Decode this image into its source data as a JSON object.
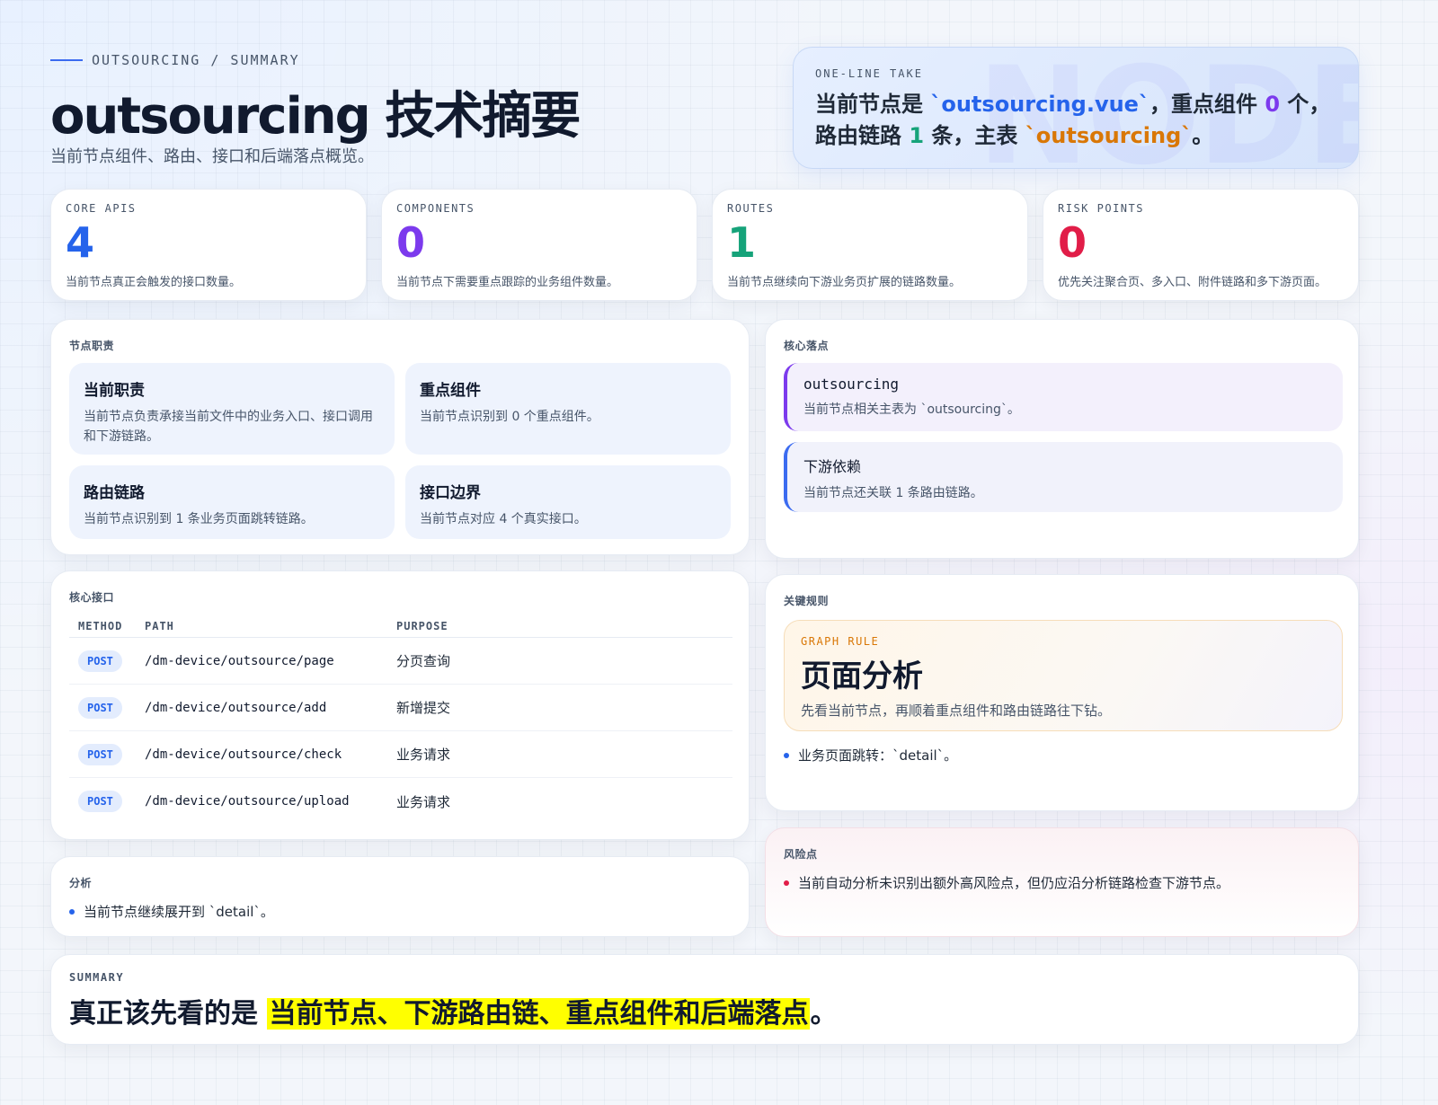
{
  "header": {
    "eyebrow": "OUTSOURCING / SUMMARY",
    "title": "outsourcing 技术摘要",
    "subtitle": "当前节点组件、路由、接口和后端落点概览。"
  },
  "take": {
    "label": "ONE-LINE TAKE",
    "watermark": "NODE",
    "p1": "当前节点是 ",
    "file": "`outsourcing.vue`",
    "p2": "，重点组件 ",
    "components": "0",
    "p3": " 个，路由链路 ",
    "routes": "1",
    "p4": " 条，主表 ",
    "table": "`outsourcing`",
    "p5": "。"
  },
  "stats": [
    {
      "label": "CORE APIS",
      "value": "4",
      "desc": "当前节点真正会触发的接口数量。",
      "color": "#2563eb"
    },
    {
      "label": "COMPONENTS",
      "value": "0",
      "desc": "当前节点下需要重点跟踪的业务组件数量。",
      "color": "#7c3aed"
    },
    {
      "label": "ROUTES",
      "value": "1",
      "desc": "当前节点继续向下游业务页扩展的链路数量。",
      "color": "#16a37a"
    },
    {
      "label": "RISK POINTS",
      "value": "0",
      "desc": "优先关注聚合页、多入口、附件链路和多下游页面。",
      "color": "#e11d48"
    }
  ],
  "duty": {
    "label": "节点职责",
    "tiles": [
      {
        "title": "当前职责",
        "desc": "当前节点负责承接当前文件中的业务入口、接口调用和下游链路。"
      },
      {
        "title": "重点组件",
        "desc": "当前节点识别到 0 个重点组件。"
      },
      {
        "title": "路由链路",
        "desc": "当前节点识别到 1 条业务页面跳转链路。"
      },
      {
        "title": "接口边界",
        "desc": "当前节点对应 4 个真实接口。"
      }
    ]
  },
  "landing": {
    "label": "核心落点",
    "items": [
      {
        "title": "outsourcing",
        "desc": "当前节点相关主表为 `outsourcing`。"
      },
      {
        "title": "下游依赖",
        "desc": "当前节点还关联 1 条路由链路。"
      }
    ]
  },
  "apis": {
    "label": "核心接口",
    "headers": {
      "method": "METHOD",
      "path": "PATH",
      "purpose": "PURPOSE"
    },
    "rows": [
      {
        "method": "POST",
        "path": "/dm-device/outsource/page",
        "purpose": "分页查询"
      },
      {
        "method": "POST",
        "path": "/dm-device/outsource/add",
        "purpose": "新增提交"
      },
      {
        "method": "POST",
        "path": "/dm-device/outsource/check",
        "purpose": "业务请求"
      },
      {
        "method": "POST",
        "path": "/dm-device/outsource/upload",
        "purpose": "业务请求"
      }
    ]
  },
  "rules": {
    "label": "关键规则",
    "box_label": "GRAPH RULE",
    "box_title": "页面分析",
    "box_desc": "先看当前节点，再顺着重点组件和路由链路往下钻。",
    "bullet": "业务页面跳转：`detail`。"
  },
  "analysis": {
    "label": "分析",
    "bullet": "当前节点继续展开到 `detail`。"
  },
  "risk": {
    "label": "风险点",
    "bullet": "当前自动分析未识别出额外高风险点，但仍应沿分析链路检查下游节点。"
  },
  "summary": {
    "label": "SUMMARY",
    "prefix": "真正该先看的是 ",
    "highlight": "当前节点、下游路由链、重点组件和后端落点",
    "suffix": "。"
  }
}
